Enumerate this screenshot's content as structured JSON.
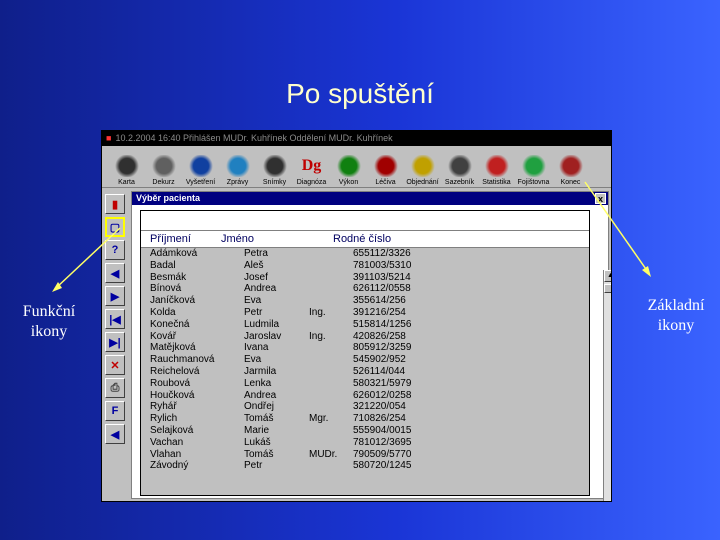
{
  "slide": {
    "title": "Po spuštění",
    "label_left": "Funkční ikony",
    "label_right": "Základní ikony"
  },
  "app": {
    "titlebar": "10.2.2004 16:40   Přihlášen  MUDr. Kuhřínek  Oddělení  MUDr. Kuhřínek",
    "toolbar": [
      {
        "label": "Karta",
        "icon": "patient-card-icon"
      },
      {
        "label": "Dekurz",
        "icon": "eye-icon"
      },
      {
        "label": "Vyšetření",
        "icon": "lab-tubes-icon"
      },
      {
        "label": "Zprávy",
        "icon": "reports-icon"
      },
      {
        "label": "Snímky",
        "icon": "xray-icon"
      },
      {
        "label": "Diagnóza",
        "icon": "dg-icon"
      },
      {
        "label": "Výkon",
        "icon": "syringe-icon"
      },
      {
        "label": "Léčiva",
        "icon": "medicine-icon"
      },
      {
        "label": "Objednání",
        "icon": "order-icon"
      },
      {
        "label": "Sazebník",
        "icon": "pricelist-icon"
      },
      {
        "label": "Statistika",
        "icon": "statistics-icon"
      },
      {
        "label": "Fojištovna",
        "icon": "insurance-icon"
      },
      {
        "label": "Konec",
        "icon": "exit-icon"
      }
    ],
    "left_buttons": [
      {
        "icon": "book-icon",
        "glyph": "▮"
      },
      {
        "icon": "window-icon",
        "glyph": "▢"
      },
      {
        "icon": "help-icon",
        "glyph": "?"
      },
      {
        "icon": "prev-icon",
        "glyph": "◀"
      },
      {
        "icon": "next-icon",
        "glyph": "▶"
      },
      {
        "icon": "first-icon",
        "glyph": "|◀"
      },
      {
        "icon": "last-icon",
        "glyph": "▶|"
      },
      {
        "icon": "delete-icon",
        "glyph": "✕"
      },
      {
        "icon": "print-icon",
        "glyph": "⎙"
      },
      {
        "icon": "filter-icon",
        "glyph": "F"
      },
      {
        "icon": "back-icon",
        "glyph": "◀"
      }
    ],
    "panel": {
      "title": "Výběr pacienta",
      "close": "x",
      "headers": [
        "Příjmení",
        "Jméno",
        "Rodné číslo"
      ],
      "rows": [
        [
          "Adámková",
          "Petra",
          "",
          "655112/3326"
        ],
        [
          "Badal",
          "Aleš",
          "",
          "781003/5310"
        ],
        [
          "Besmák",
          "Josef",
          "",
          "391103/5214"
        ],
        [
          "Bínová",
          "Andrea",
          "",
          "626112/0558"
        ],
        [
          "Janíčková",
          "Eva",
          "",
          "355614/256"
        ],
        [
          "Kolda",
          "Petr",
          "Ing.",
          "391216/254"
        ],
        [
          "Konečná",
          "Ludmila",
          "",
          "515814/1256"
        ],
        [
          "Kovář",
          "Jaroslav",
          "Ing.",
          "420826/258"
        ],
        [
          "Matějková",
          "Ivana",
          "",
          "805912/3259"
        ],
        [
          "Rauchmanová",
          "Eva",
          "",
          "545902/952"
        ],
        [
          "Reichelová",
          "Jarmila",
          "",
          "526114/044"
        ],
        [
          "Roubová",
          "Lenka",
          "",
          "580321/5979"
        ],
        [
          "Houčková",
          "Andrea",
          "",
          "626012/0258"
        ],
        [
          "Ryhář",
          "Ondřej",
          "",
          "321220/054"
        ],
        [
          "Rylich",
          "Tomáš",
          "Mgr.",
          "710826/254"
        ],
        [
          "Selajková",
          "Marie",
          "",
          "555904/0015"
        ],
        [
          "Vachan",
          "Lukáš",
          "",
          "781012/3695"
        ],
        [
          "Vlahan",
          "Tomáš",
          "MUDr.",
          "790509/5770"
        ],
        [
          "Závodný",
          "Petr",
          "",
          "580720/1245"
        ]
      ]
    }
  }
}
